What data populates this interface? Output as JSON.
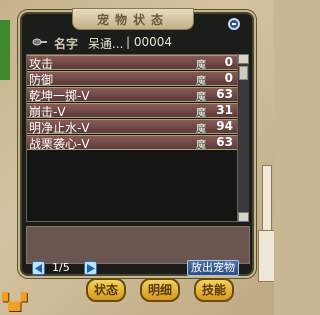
{
  "window": {
    "title": "宠物状态"
  },
  "header": {
    "label": "名字",
    "name": "呆通...",
    "id": "| 00004"
  },
  "rows": [
    {
      "name": "攻击",
      "mo": "魔",
      "value": "0"
    },
    {
      "name": "防御",
      "mo": "魔",
      "value": "0"
    },
    {
      "name": "乾坤一掷-V",
      "mo": "魔",
      "value": "63"
    },
    {
      "name": "崩击-V",
      "mo": "魔",
      "value": "31"
    },
    {
      "name": "明净止水-V",
      "mo": "魔",
      "value": "94"
    },
    {
      "name": "战栗袭心-V",
      "mo": "魔",
      "value": "63"
    }
  ],
  "pager": {
    "text": "1/5"
  },
  "buttons": {
    "release": "放出宠物"
  },
  "tabs": {
    "status": "状态",
    "detail": "明细",
    "skill": "技能"
  },
  "colors": {
    "row": "#7a4f4c",
    "tab": "#e6b43a",
    "frame": "#1b1d1b"
  }
}
